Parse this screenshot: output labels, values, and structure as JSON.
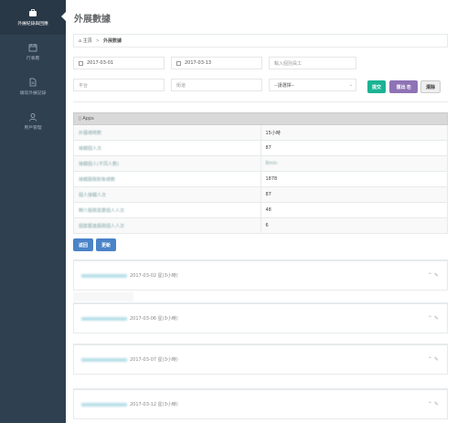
{
  "sidebar": {
    "items": [
      {
        "label": "外展紀錄與回應",
        "icon": "briefcase-icon",
        "active": true
      },
      {
        "label": "行事曆",
        "icon": "calendar-icon",
        "active": false
      },
      {
        "label": "填寫外展記錄",
        "icon": "document-icon",
        "active": false
      },
      {
        "label": "用戶管理",
        "icon": "user-icon",
        "active": false
      }
    ]
  },
  "page": {
    "title": "外展數據"
  },
  "breadcrumb": {
    "home": "主頁",
    "current": "外展數據"
  },
  "filters": {
    "date_from": "2017-03-01",
    "date_to": "2017-03-13",
    "worker_placeholder": "輸入個別員工",
    "region_placeholder": "平台",
    "station_placeholder": "街道",
    "select_value": "--請選擇--",
    "submit": "提交",
    "export": "匯出 ⎘",
    "clear": "清除"
  },
  "table": {
    "header": "Apps",
    "rows": [
      {
        "label": "外展總時數",
        "value": "15小時"
      },
      {
        "label": "接觸個人次",
        "value": "87"
      },
      {
        "label": "接觸個人(不同人數)",
        "value": "Bmin"
      },
      {
        "label": "接觸服務對象總數",
        "value": "1878"
      },
      {
        "label": "個人接觸人次",
        "value": "87"
      },
      {
        "label": "轉介服務需要個人人次",
        "value": "48"
      },
      {
        "label": "個案跟進服務個人人次",
        "value": "6"
      }
    ]
  },
  "actions": {
    "back": "返回",
    "refresh": "更新"
  },
  "records": [
    {
      "date": "2017-03-02",
      "detail": "星(3小時)"
    },
    {
      "date": "2017-03-06",
      "detail": "星(3小時)"
    },
    {
      "date": "2017-03-07",
      "detail": "星(3小時)"
    },
    {
      "date": "2017-03-12",
      "detail": "星(3小時)"
    }
  ],
  "colors": {
    "sidebar": "#2f4050",
    "submit": "#1ab394",
    "export": "#8e73b5",
    "action": "#4a83c7"
  }
}
